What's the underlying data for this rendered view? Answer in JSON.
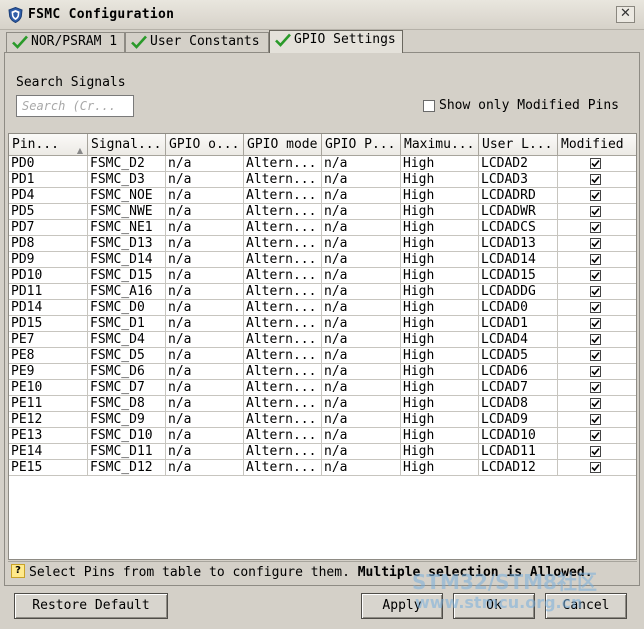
{
  "window": {
    "title": "FSMC Configuration",
    "close_glyph": "✕"
  },
  "tabs": [
    {
      "label": "NOR/PSRAM 1",
      "icon": "check-icon",
      "active": false
    },
    {
      "label": "User Constants",
      "icon": "check-icon",
      "active": false
    },
    {
      "label": "GPIO Settings",
      "icon": "check-icon",
      "active": true
    }
  ],
  "search": {
    "label": "Search Signals",
    "placeholder": "Search (Cr..."
  },
  "modified_only": {
    "label": "Show only Modified Pins",
    "checked": false
  },
  "table": {
    "columns": [
      "Pin...",
      "Signal...",
      "GPIO o...",
      "GPIO mode",
      "GPIO P...",
      "Maximu...",
      "User L...",
      "Modified"
    ],
    "rows": [
      {
        "pin": "PD0",
        "signal": "FSMC_D2",
        "output": "n/a",
        "mode": "Altern...",
        "pull": "n/a",
        "speed": "High",
        "label": "LCDAD2",
        "modified": true
      },
      {
        "pin": "PD1",
        "signal": "FSMC_D3",
        "output": "n/a",
        "mode": "Altern...",
        "pull": "n/a",
        "speed": "High",
        "label": "LCDAD3",
        "modified": true
      },
      {
        "pin": "PD4",
        "signal": "FSMC_NOE",
        "output": "n/a",
        "mode": "Altern...",
        "pull": "n/a",
        "speed": "High",
        "label": "LCDADRD",
        "modified": true
      },
      {
        "pin": "PD5",
        "signal": "FSMC_NWE",
        "output": "n/a",
        "mode": "Altern...",
        "pull": "n/a",
        "speed": "High",
        "label": "LCDADWR",
        "modified": true
      },
      {
        "pin": "PD7",
        "signal": "FSMC_NE1",
        "output": "n/a",
        "mode": "Altern...",
        "pull": "n/a",
        "speed": "High",
        "label": "LCDADCS",
        "modified": true
      },
      {
        "pin": "PD8",
        "signal": "FSMC_D13",
        "output": "n/a",
        "mode": "Altern...",
        "pull": "n/a",
        "speed": "High",
        "label": "LCDAD13",
        "modified": true
      },
      {
        "pin": "PD9",
        "signal": "FSMC_D14",
        "output": "n/a",
        "mode": "Altern...",
        "pull": "n/a",
        "speed": "High",
        "label": "LCDAD14",
        "modified": true
      },
      {
        "pin": "PD10",
        "signal": "FSMC_D15",
        "output": "n/a",
        "mode": "Altern...",
        "pull": "n/a",
        "speed": "High",
        "label": "LCDAD15",
        "modified": true
      },
      {
        "pin": "PD11",
        "signal": "FSMC_A16",
        "output": "n/a",
        "mode": "Altern...",
        "pull": "n/a",
        "speed": "High",
        "label": "LCDADDG",
        "modified": true
      },
      {
        "pin": "PD14",
        "signal": "FSMC_D0",
        "output": "n/a",
        "mode": "Altern...",
        "pull": "n/a",
        "speed": "High",
        "label": "LCDAD0",
        "modified": true
      },
      {
        "pin": "PD15",
        "signal": "FSMC_D1",
        "output": "n/a",
        "mode": "Altern...",
        "pull": "n/a",
        "speed": "High",
        "label": "LCDAD1",
        "modified": true
      },
      {
        "pin": "PE7",
        "signal": "FSMC_D4",
        "output": "n/a",
        "mode": "Altern...",
        "pull": "n/a",
        "speed": "High",
        "label": "LCDAD4",
        "modified": true
      },
      {
        "pin": "PE8",
        "signal": "FSMC_D5",
        "output": "n/a",
        "mode": "Altern...",
        "pull": "n/a",
        "speed": "High",
        "label": "LCDAD5",
        "modified": true
      },
      {
        "pin": "PE9",
        "signal": "FSMC_D6",
        "output": "n/a",
        "mode": "Altern...",
        "pull": "n/a",
        "speed": "High",
        "label": "LCDAD6",
        "modified": true
      },
      {
        "pin": "PE10",
        "signal": "FSMC_D7",
        "output": "n/a",
        "mode": "Altern...",
        "pull": "n/a",
        "speed": "High",
        "label": "LCDAD7",
        "modified": true
      },
      {
        "pin": "PE11",
        "signal": "FSMC_D8",
        "output": "n/a",
        "mode": "Altern...",
        "pull": "n/a",
        "speed": "High",
        "label": "LCDAD8",
        "modified": true
      },
      {
        "pin": "PE12",
        "signal": "FSMC_D9",
        "output": "n/a",
        "mode": "Altern...",
        "pull": "n/a",
        "speed": "High",
        "label": "LCDAD9",
        "modified": true
      },
      {
        "pin": "PE13",
        "signal": "FSMC_D10",
        "output": "n/a",
        "mode": "Altern...",
        "pull": "n/a",
        "speed": "High",
        "label": "LCDAD10",
        "modified": true
      },
      {
        "pin": "PE14",
        "signal": "FSMC_D11",
        "output": "n/a",
        "mode": "Altern...",
        "pull": "n/a",
        "speed": "High",
        "label": "LCDAD11",
        "modified": true
      },
      {
        "pin": "PE15",
        "signal": "FSMC_D12",
        "output": "n/a",
        "mode": "Altern...",
        "pull": "n/a",
        "speed": "High",
        "label": "LCDAD12",
        "modified": true
      }
    ]
  },
  "status": {
    "icon": "info-icon",
    "icon_glyph": "?",
    "text": "Select Pins from table to configure them. ",
    "bold_text": "Multiple selection is Allowed."
  },
  "buttons": {
    "restore": "Restore Default",
    "apply": "Apply",
    "ok": "Ok",
    "cancel": "Cancel"
  },
  "watermark": {
    "line1": "STM32/STM8社区",
    "line2": "www.stmcu.org.cn"
  },
  "colors": {
    "check_green": "#2a9a2a",
    "title_bg": "#e2dfd7",
    "dialog_bg": "#d4d0c8",
    "shield_blue": "#2f5ea8"
  }
}
